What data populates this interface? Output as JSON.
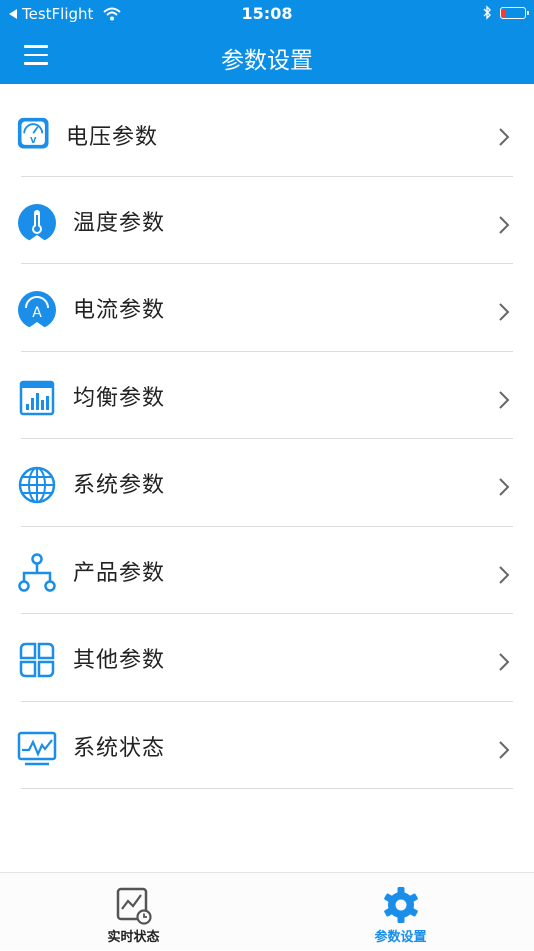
{
  "status_bar": {
    "back_app": "TestFlight",
    "time": "15:08",
    "icons": [
      "back-arrow-icon",
      "wifi-icon",
      "bluetooth-icon",
      "battery-icon"
    ]
  },
  "nav": {
    "title": "参数设置",
    "menu_icon": "hamburger-menu-icon"
  },
  "colors": {
    "brand": "#0a8ee6",
    "icon_blue": "#1a8ee8",
    "battery_low": "#ff3b30"
  },
  "list": {
    "items": [
      {
        "label": "电压参数",
        "icon": "voltmeter-icon"
      },
      {
        "label": "温度参数",
        "icon": "thermometer-icon"
      },
      {
        "label": "电流参数",
        "icon": "ammeter-icon"
      },
      {
        "label": "均衡参数",
        "icon": "equalizer-icon"
      },
      {
        "label": "系统参数",
        "icon": "globe-icon"
      },
      {
        "label": "产品参数",
        "icon": "hierarchy-icon"
      },
      {
        "label": "其他参数",
        "icon": "grid-icon"
      },
      {
        "label": "系统状态",
        "icon": "monitor-wave-icon"
      }
    ]
  },
  "tab_bar": {
    "tabs": [
      {
        "label": "实时状态",
        "icon": "chart-clock-icon",
        "active": false
      },
      {
        "label": "参数设置",
        "icon": "gear-icon",
        "active": true
      }
    ]
  }
}
